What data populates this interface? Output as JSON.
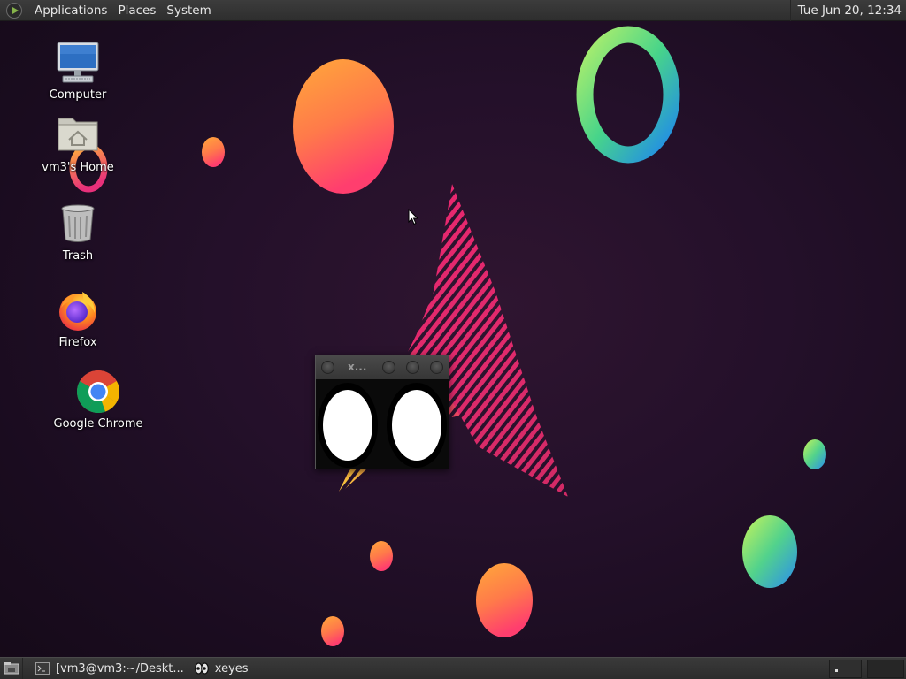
{
  "top_panel": {
    "menus": [
      "Applications",
      "Places",
      "System"
    ],
    "clock": "Tue Jun 20, 12:34",
    "logo_icon": "mate-menu-icon"
  },
  "desktop": {
    "icons": [
      {
        "label": "Computer",
        "icon": "computer-icon"
      },
      {
        "label": "vm3's Home",
        "icon": "home-folder-icon"
      },
      {
        "label": "Trash",
        "icon": "trash-icon"
      },
      {
        "label": "Firefox",
        "icon": "firefox-icon"
      },
      {
        "label": "Google Chrome",
        "icon": "chrome-icon"
      }
    ]
  },
  "xeyes_window": {
    "title": "x..."
  },
  "bottom_panel": {
    "tasks": [
      {
        "label": "[vm3@vm3:~/Deskt...",
        "icon": "terminal-icon"
      },
      {
        "label": "xeyes",
        "icon": "xeyes-icon"
      }
    ],
    "workspaces": 4,
    "active_workspace": 1
  },
  "colors": {
    "panel": "#333333",
    "wallpaper_bg": "#24102a",
    "accent_pink": "#e8266d",
    "accent_orange": "#ffa238"
  }
}
